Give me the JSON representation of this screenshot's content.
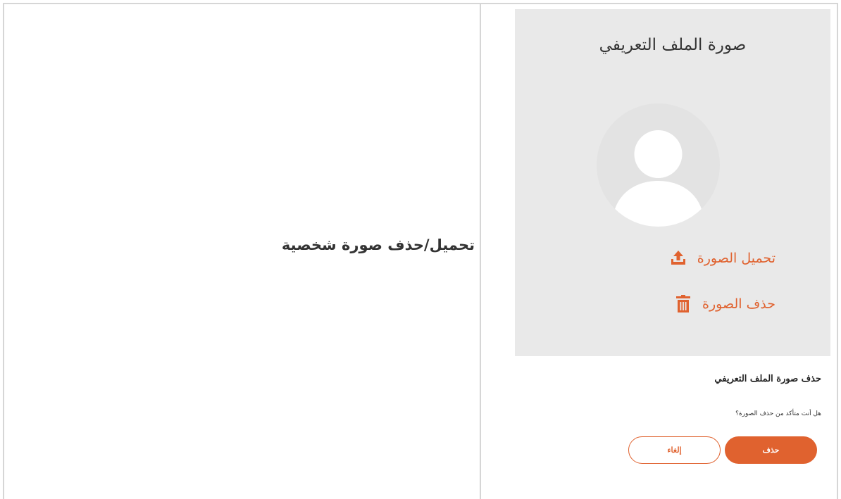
{
  "caption": "تحميل/حذف صورة شخصية",
  "profile_card": {
    "title": "صورة الملف التعريفي",
    "avatar_icon": "default-user-silhouette-icon",
    "actions": [
      {
        "label": "تحميل الصورة",
        "icon": "upload-icon"
      },
      {
        "label": "حذف الصورة",
        "icon": "trash-icon"
      }
    ]
  },
  "confirm_dialog": {
    "title": "حذف صورة الملف التعريفي",
    "message": "هل أنت متأكد من حذف الصورة؟",
    "confirm_label": "حذف",
    "cancel_label": "إلغاء"
  },
  "colors": {
    "accent": "#e0622f",
    "card_background": "#e9e9e9",
    "avatar_background": "#e3e3e3",
    "divider": "#d6d6d6"
  }
}
